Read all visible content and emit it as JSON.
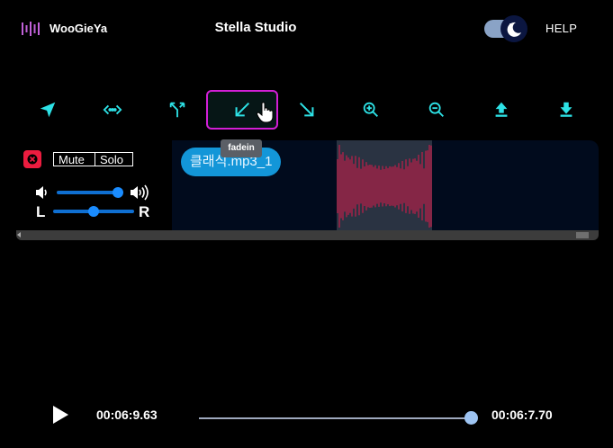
{
  "header": {
    "brand": "WooGieYa",
    "title": "Stella Studio",
    "help_label": "HELP",
    "logo_icon": "sound-bars-icon",
    "theme_toggle_icon": "moon-icon"
  },
  "toolbar": {
    "tools": [
      {
        "name": "cursor-tool",
        "icon": "navigation-arrow-icon"
      },
      {
        "name": "shift-tool",
        "icon": "horizontal-arrows-icon"
      },
      {
        "name": "split-tool",
        "icon": "split-arrows-icon"
      },
      {
        "name": "fadein-tool",
        "icon": "arrow-down-left-icon",
        "active": true
      },
      {
        "name": "fadeout-tool",
        "icon": "arrow-down-right-icon"
      },
      {
        "name": "zoom-in-tool",
        "icon": "zoom-in-icon"
      },
      {
        "name": "zoom-out-tool",
        "icon": "zoom-out-icon"
      },
      {
        "name": "upload-tool",
        "icon": "upload-icon"
      },
      {
        "name": "download-tool",
        "icon": "download-icon"
      }
    ],
    "tooltip": "fadein"
  },
  "track": {
    "mute_label": "Mute",
    "solo_label": "Solo",
    "left_label": "L",
    "right_label": "R",
    "volume": 0.9,
    "pan": 0.5,
    "clip_label": "클래식.mp3_1"
  },
  "playback": {
    "current_time": "00:06:9.63",
    "total_time": "00:06:7.70",
    "progress": 1.0
  },
  "colors": {
    "accent": "#2de2e6",
    "active_border": "#d21fd6",
    "waveform": "#e0184a",
    "clip": "#1396d8",
    "close": "#ec1c3f"
  }
}
